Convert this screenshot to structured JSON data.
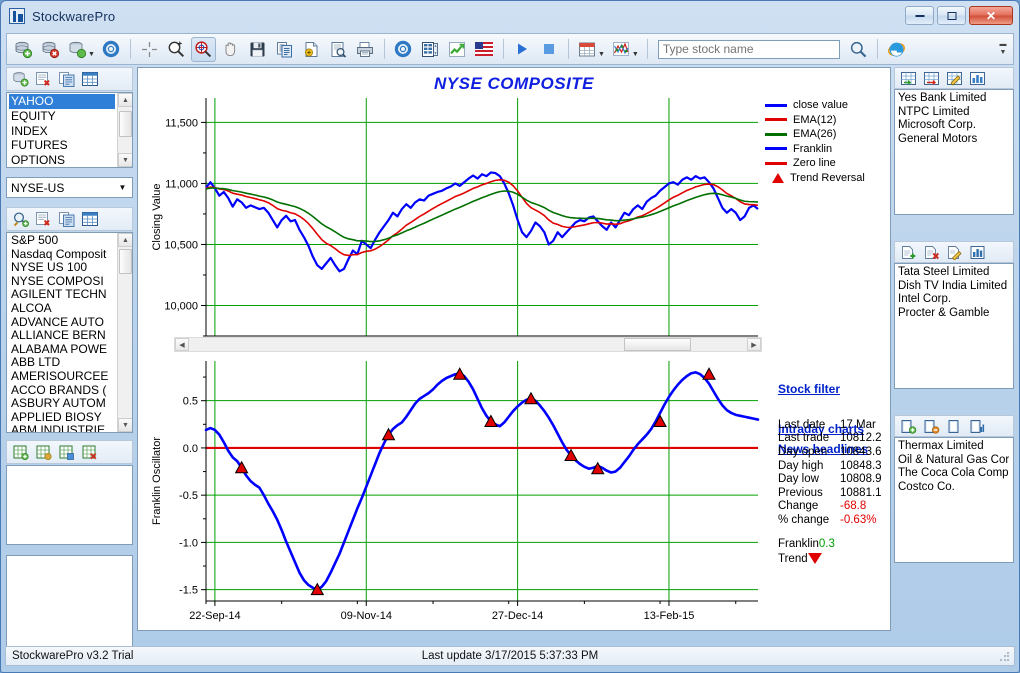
{
  "window": {
    "title": "StockwarePro",
    "app_icon": "stockware-icon",
    "buttons": {
      "minimize": "minimize",
      "maximize": "maximize",
      "close": "close"
    }
  },
  "toolbar": {
    "groups": [
      [
        {
          "name": "add-database-icon",
          "label": ""
        },
        {
          "name": "remove-database-icon",
          "label": ""
        },
        {
          "name": "database-dropdown-icon",
          "label": "",
          "caret": "▾"
        },
        {
          "name": "database-settings-icon",
          "label": ""
        }
      ],
      [
        {
          "name": "crosshair-icon",
          "label": ""
        },
        {
          "name": "zoom-in-icon",
          "label": ""
        },
        {
          "name": "zoom-region-icon",
          "label": "",
          "pressed": true
        },
        {
          "name": "pan-hand-icon",
          "label": ""
        },
        {
          "name": "save-icon",
          "label": ""
        },
        {
          "name": "copy-icon",
          "label": ""
        },
        {
          "name": "export-page-icon",
          "label": ""
        },
        {
          "name": "print-preview-icon",
          "label": ""
        },
        {
          "name": "print-icon",
          "label": ""
        }
      ],
      [
        {
          "name": "settings-gear-icon",
          "label": ""
        },
        {
          "name": "spreadsheet-icon",
          "label": ""
        },
        {
          "name": "trend-chart-icon",
          "label": ""
        },
        {
          "name": "us-flag-icon",
          "label": ""
        }
      ],
      [
        {
          "name": "play-icon",
          "label": ""
        },
        {
          "name": "stop-icon",
          "label": ""
        }
      ],
      [
        {
          "name": "calendar-icon",
          "label": "",
          "caret": "▾"
        },
        {
          "name": "indicator-chart-icon",
          "label": "",
          "caret": "▾"
        }
      ]
    ],
    "search": {
      "placeholder": "Type stock name",
      "value": ""
    },
    "search_button": "search-icon",
    "browser_button": "internet-explorer-icon",
    "overflow": "toolbar-overflow-icon"
  },
  "left_panel": {
    "source_toolbar": [
      {
        "name": "add-source-icon"
      },
      {
        "name": "delete-source-icon"
      },
      {
        "name": "source-dropdown-icon"
      },
      {
        "name": "source-settings-icon"
      }
    ],
    "source_list": {
      "items": [
        "YAHOO",
        "EQUITY",
        "INDEX",
        "FUTURES",
        "OPTIONS"
      ],
      "selected": "YAHOO"
    },
    "market_combo": {
      "value": "NYSE-US",
      "caret": "▾"
    },
    "symbol_toolbar": [
      {
        "name": "find-symbol-icon"
      },
      {
        "name": "delete-symbol-icon"
      },
      {
        "name": "copy-symbol-icon"
      },
      {
        "name": "symbol-table-icon"
      }
    ],
    "symbol_list": {
      "items": [
        "S&P 500",
        "Nasdaq Composit",
        "NYSE US 100",
        "NYSE COMPOSI",
        "AGILENT TECHN",
        "ALCOA",
        "ADVANCE AUTO",
        "ALLIANCE BERN",
        "ALABAMA POWE",
        "ABB LTD",
        "AMERISOURCEE",
        "ACCO BRANDS (",
        "ASBURY AUTOM",
        "APPLIED BIOSY",
        "ABM INDUSTRIE"
      ]
    },
    "portfolio_toolbar": [
      {
        "name": "new-portfolio-icon"
      },
      {
        "name": "open-portfolio-icon"
      },
      {
        "name": "save-portfolio-icon"
      },
      {
        "name": "close-portfolio-icon"
      }
    ],
    "portfolio_list": {
      "items": []
    },
    "notes_list": {
      "items": []
    }
  },
  "chart_area": {
    "title": "NYSE COMPOSITE",
    "legend": [
      {
        "label": "close value",
        "type": "line",
        "color": "#0000ff"
      },
      {
        "label": "EMA(12)",
        "type": "line",
        "color": "#e00000"
      },
      {
        "label": "EMA(26)",
        "type": "line",
        "color": "#007000"
      },
      {
        "label": "Franklin",
        "type": "line",
        "color": "#0000ff"
      },
      {
        "label": "Zero line",
        "type": "line",
        "color": "#e00000"
      },
      {
        "label": "Trend Reversal",
        "type": "triangle",
        "color": "#e00000"
      }
    ],
    "links": [
      {
        "label": "Stock filter",
        "name": "stock-filter-link"
      },
      {
        "label": "Intraday charts",
        "name": "intraday-charts-link"
      },
      {
        "label": "News headlines",
        "name": "news-headlines-link"
      }
    ],
    "quote": [
      {
        "label": "Last date",
        "value": "17 Mar",
        "style": "normal"
      },
      {
        "label": "Last trade",
        "value": "10812.2",
        "style": "normal"
      },
      {
        "label": "Day open",
        "value": "10843.6",
        "style": "normal"
      },
      {
        "label": "Day high",
        "value": "10848.3",
        "style": "normal"
      },
      {
        "label": "Day low",
        "value": "10808.9",
        "style": "normal"
      },
      {
        "label": "Previous",
        "value": "10881.1",
        "style": "normal"
      },
      {
        "label": "Change",
        "value": "-68.8",
        "style": "neg"
      },
      {
        "label": "% change",
        "value": "-0.63%",
        "style": "neg"
      }
    ],
    "franklin": {
      "label": "Franklin",
      "value": "0.3",
      "trend_label": "Trend",
      "trend_direction": "down"
    }
  },
  "chart_data": [
    {
      "type": "line",
      "title": "NYSE COMPOSITE",
      "panel": "price",
      "xlabel": "",
      "ylabel": "Closing Value",
      "ylim": [
        9750,
        11700
      ],
      "yticks": [
        10000,
        10500,
        11000,
        11500
      ],
      "ytick_labels": [
        "10,000",
        "10,500",
        "11,000",
        "11,500"
      ],
      "xlim": [
        0,
        124
      ],
      "xticks": [
        2,
        36,
        70,
        104
      ],
      "xtick_labels": [
        "22-Sep-14",
        "09-Nov-14",
        "27-Dec-14",
        "13-Feb-15"
      ],
      "grid": true,
      "legend_position": "top-right",
      "series": [
        {
          "name": "close value",
          "color": "#0000ff",
          "values": [
            10965,
            11010,
            10960,
            10900,
            10930,
            10880,
            10810,
            10870,
            10845,
            10800,
            10820,
            10805,
            10790,
            10800,
            10760,
            10700,
            10640,
            10700,
            10735,
            10690,
            10700,
            10620,
            10560,
            10490,
            10400,
            10330,
            10300,
            10345,
            10390,
            10330,
            10280,
            10300,
            10380,
            10450,
            10420,
            10530,
            10500,
            10470,
            10540,
            10600,
            10650,
            10700,
            10760,
            10730,
            10790,
            10830,
            10800,
            10845,
            10870,
            10860,
            10900,
            10915,
            10930,
            10940,
            10960,
            10975,
            11000,
            10980,
            11010,
            11040,
            11065,
            11040,
            11075,
            11060,
            11090,
            11085,
            11060,
            11000,
            10920,
            10820,
            10700,
            10600,
            10560,
            10610,
            10680,
            10650,
            10600,
            10500,
            10530,
            10600,
            10560,
            10600,
            10640,
            10680,
            10700,
            10690,
            10720,
            10730,
            10690,
            10650,
            10620,
            10680,
            10640,
            10700,
            10760,
            10740,
            10790,
            10820,
            10790,
            10850,
            10880,
            10900,
            10940,
            10970,
            11000,
            11010,
            10990,
            11030,
            11050,
            11030,
            11060,
            11040,
            11050,
            11010,
            10960,
            10880,
            10800,
            10760,
            10790,
            10760,
            10700,
            10730,
            10800,
            10820,
            10790
          ]
        },
        {
          "name": "EMA(12)",
          "color": "#e00000",
          "values": [
            10960,
            10970,
            10965,
            10955,
            10950,
            10938,
            10920,
            10912,
            10905,
            10893,
            10885,
            10876,
            10866,
            10857,
            10842,
            10820,
            10794,
            10780,
            10773,
            10760,
            10751,
            10731,
            10705,
            10672,
            10630,
            10584,
            10540,
            10510,
            10491,
            10466,
            10437,
            10416,
            10410,
            10416,
            10417,
            10434,
            10444,
            10448,
            10462,
            10483,
            10509,
            10538,
            10572,
            10596,
            10626,
            10658,
            10680,
            10705,
            10730,
            10750,
            10773,
            10795,
            10816,
            10835,
            10854,
            10873,
            10893,
            10906,
            10922,
            10940,
            10959,
            10972,
            10988,
            11000,
            11014,
            11025,
            11030,
            11026,
            11010,
            10981,
            10938,
            10886,
            10836,
            10801,
            10782,
            10762,
            10737,
            10701,
            10675,
            10664,
            10648,
            10641,
            10640,
            10646,
            10654,
            10660,
            10669,
            10678,
            10680,
            10675,
            10667,
            10669,
            10665,
            10670,
            10684,
            10693,
            10708,
            10725,
            10735,
            10753,
            10773,
            10793,
            10816,
            10840,
            10865,
            10887,
            10903,
            10923,
            10942,
            10956,
            10972,
            10982,
            10992,
            10995,
            10990,
            10973,
            10947,
            10918,
            10898,
            10877,
            10850,
            10832,
            10827,
            10826,
            10821
          ]
        },
        {
          "name": "EMA(26)",
          "color": "#007000",
          "values": [
            10955,
            10962,
            10962,
            10959,
            10957,
            10951,
            10941,
            10936,
            10929,
            10920,
            10913,
            10905,
            10896,
            10889,
            10879,
            10865,
            10848,
            10837,
            10829,
            10819,
            10810,
            10796,
            10778,
            10756,
            10729,
            10699,
            10669,
            10645,
            10626,
            10604,
            10580,
            10559,
            10546,
            10539,
            10530,
            10530,
            10528,
            10524,
            10525,
            10530,
            10539,
            10551,
            10567,
            10579,
            10595,
            10612,
            10626,
            10642,
            10659,
            10674,
            10691,
            10708,
            10724,
            10740,
            10757,
            10773,
            10790,
            10804,
            10820,
            10836,
            10853,
            10867,
            10883,
            10896,
            10910,
            10923,
            10933,
            10938,
            10937,
            10928,
            10911,
            10888,
            10863,
            10844,
            10832,
            10818,
            10802,
            10780,
            10762,
            10750,
            10736,
            10726,
            10719,
            10716,
            10715,
            10713,
            10714,
            10715,
            10713,
            10708,
            10702,
            10700,
            10695,
            10695,
            10700,
            10703,
            10710,
            10718,
            10724,
            10733,
            10744,
            10756,
            10770,
            10785,
            10801,
            10816,
            10829,
            10844,
            10859,
            10872,
            10886,
            10897,
            10908,
            10916,
            10919,
            10916,
            10907,
            10896,
            10888,
            10878,
            10864,
            10854,
            10851,
            10850,
            10847
          ]
        }
      ]
    },
    {
      "type": "line",
      "panel": "oscillator",
      "xlabel": "",
      "ylabel": "Franklin Oscillator",
      "ylim": [
        -1.62,
        0.92
      ],
      "yticks": [
        0.5,
        0.0,
        -0.5,
        -1.0,
        -1.5
      ],
      "ytick_labels": [
        "0.5",
        "0.0",
        "-0.5",
        "-1.0",
        "-1.5"
      ],
      "xlim": [
        0,
        124
      ],
      "xticks": [
        2,
        36,
        70,
        104
      ],
      "xtick_labels": [
        "22-Sep-14",
        "09-Nov-14",
        "27-Dec-14",
        "13-Feb-15"
      ],
      "grid": true,
      "zero_line": 0.0,
      "series": [
        {
          "name": "Franklin",
          "color": "#0000ff",
          "values": [
            0.19,
            0.21,
            0.19,
            0.14,
            0.06,
            -0.03,
            -0.1,
            -0.14,
            -0.21,
            -0.29,
            -0.35,
            -0.39,
            -0.42,
            -0.5,
            -0.59,
            -0.67,
            -0.76,
            -0.87,
            -0.99,
            -1.1,
            -1.21,
            -1.32,
            -1.4,
            -1.45,
            -1.48,
            -1.5,
            -1.47,
            -1.41,
            -1.32,
            -1.22,
            -1.12,
            -1.0,
            -0.88,
            -0.76,
            -0.64,
            -0.53,
            -0.41,
            -0.29,
            -0.17,
            -0.05,
            0.05,
            0.14,
            0.2,
            0.24,
            0.27,
            0.33,
            0.4,
            0.47,
            0.52,
            0.55,
            0.58,
            0.62,
            0.67,
            0.71,
            0.74,
            0.76,
            0.78,
            0.79,
            0.76,
            0.7,
            0.62,
            0.52,
            0.42,
            0.34,
            0.28,
            0.25,
            0.23,
            0.27,
            0.33,
            0.39,
            0.44,
            0.48,
            0.51,
            0.52,
            0.5,
            0.45,
            0.39,
            0.32,
            0.24,
            0.15,
            0.06,
            -0.02,
            -0.08,
            -0.13,
            -0.17,
            -0.2,
            -0.22,
            -0.21,
            -0.19,
            -0.21,
            -0.24,
            -0.26,
            -0.25,
            -0.21,
            -0.15,
            -0.09,
            -0.02,
            0.04,
            0.09,
            0.14,
            0.2,
            0.28,
            0.37,
            0.46,
            0.54,
            0.61,
            0.67,
            0.72,
            0.76,
            0.79,
            0.8,
            0.78,
            0.74,
            0.68,
            0.6,
            0.52,
            0.45,
            0.4,
            0.37,
            0.35,
            0.34,
            0.33,
            0.32,
            0.31,
            0.3
          ]
        }
      ],
      "markers": {
        "name": "Trend Reversal",
        "color": "#e00000",
        "points": [
          {
            "x": 8,
            "y": -0.21
          },
          {
            "x": 25,
            "y": -1.5
          },
          {
            "x": 41,
            "y": 0.14
          },
          {
            "x": 57,
            "y": 0.78
          },
          {
            "x": 64,
            "y": 0.28
          },
          {
            "x": 73,
            "y": 0.52
          },
          {
            "x": 82,
            "y": -0.08
          },
          {
            "x": 88,
            "y": -0.22
          },
          {
            "x": 102,
            "y": 0.28
          },
          {
            "x": 113,
            "y": 0.78
          }
        ]
      }
    }
  ],
  "right_panel": {
    "group1": {
      "toolbar": [
        {
          "name": "import-watchlist-icon"
        },
        {
          "name": "export-watchlist-icon"
        },
        {
          "name": "edit-watchlist-icon"
        },
        {
          "name": "watchlist-chart-icon"
        }
      ],
      "items": [
        "Yes Bank Limited",
        "NTPC Limited",
        "Microsoft Corp.",
        "General Motors"
      ]
    },
    "group2": {
      "toolbar": [
        {
          "name": "add-item-icon"
        },
        {
          "name": "delete-item-icon"
        },
        {
          "name": "edit-item-icon"
        },
        {
          "name": "item-chart-icon"
        }
      ],
      "items": [
        "Tata Steel Limited",
        "Dish TV India Limited",
        "Intel Corp.",
        "Procter & Gamble"
      ]
    },
    "group3": {
      "toolbar": [
        {
          "name": "new-group-icon"
        },
        {
          "name": "remove-group-icon"
        },
        {
          "name": "copy-group-icon"
        },
        {
          "name": "group-report-icon"
        }
      ],
      "items": [
        "Thermax Limited",
        "Oil & Natural Gas Cor",
        "The Coca Cola Comp",
        "Costco Co."
      ]
    }
  },
  "statusbar": {
    "left": "StockwarePro v3.2 Trial",
    "center": "Last update 3/17/2015 5:37:33 PM"
  }
}
